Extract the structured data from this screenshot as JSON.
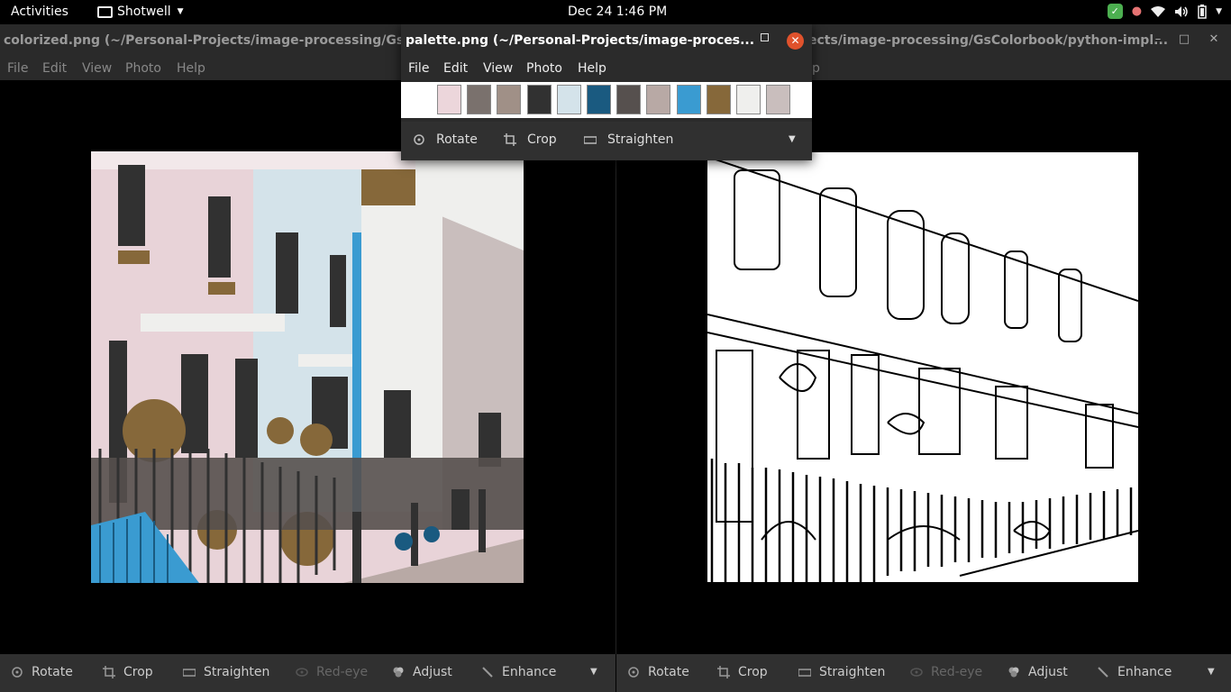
{
  "topbar": {
    "activities": "Activities",
    "app_name": "Shotwell",
    "clock": "Dec 24  1:46 PM",
    "tray_icons": [
      "shield-check-icon",
      "color-picker-icon",
      "wifi-icon",
      "volume-icon",
      "battery-icon",
      "system-menu-caret-icon"
    ]
  },
  "main_window": {
    "title_left": "colorized.png (~/Personal-Projects/image-processing/GsColorbook/python-impl...",
    "title_right": "ects/image-processing/GsColorbook/python-impl...",
    "menu": [
      "File",
      "Edit",
      "View",
      "Photo",
      "Help"
    ],
    "menu_right_fragment": "p"
  },
  "palette_window": {
    "title": "palette.png (~/Personal-Projects/image-proces...",
    "menu": [
      "File",
      "Edit",
      "View",
      "Photo",
      "Help"
    ],
    "swatches": [
      "#ecd6db",
      "#7a716d",
      "#a09087",
      "#313131",
      "#d4e3ea",
      "#1a5a80",
      "#56504e",
      "#b8a9a5",
      "#3a9bd1",
      "#86683a",
      "#efefed",
      "#c9bebd"
    ],
    "toolbar": {
      "rotate": "Rotate",
      "crop": "Crop",
      "straighten": "Straighten"
    }
  },
  "toolbar_left": {
    "rotate": "Rotate",
    "crop": "Crop",
    "straighten": "Straighten",
    "redeye": "Red-eye",
    "adjust": "Adjust",
    "enhance": "Enhance"
  },
  "toolbar_right": {
    "rotate": "Rotate",
    "crop": "Crop",
    "straighten": "Straighten",
    "redeye": "Red-eye",
    "adjust": "Adjust",
    "enhance": "Enhance"
  },
  "colors": {
    "panel": "#303030",
    "titlebar": "#2a2a2a",
    "close_button": "#e0522c",
    "accent_blue": "#3a9bd1"
  }
}
